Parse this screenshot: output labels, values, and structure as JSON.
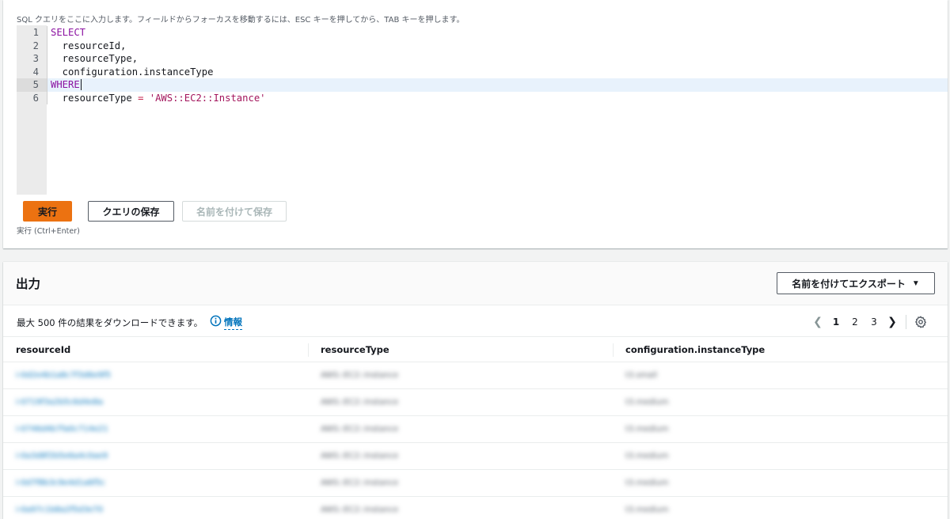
{
  "editor": {
    "hint": "SQL クエリをここに入力します。フィールドからフォーカスを移動するには、ESC キーを押してから、TAB キーを押します。",
    "lines": [
      {
        "num": "1",
        "segments": [
          {
            "t": "SELECT",
            "c": "kw"
          }
        ]
      },
      {
        "num": "2",
        "segments": [
          {
            "t": "  resourceId,",
            "c": ""
          }
        ]
      },
      {
        "num": "3",
        "segments": [
          {
            "t": "  resourceType,",
            "c": ""
          }
        ]
      },
      {
        "num": "4",
        "segments": [
          {
            "t": "  configuration.instanceType",
            "c": ""
          }
        ]
      },
      {
        "num": "5",
        "segments": [
          {
            "t": "WHERE",
            "c": "kw"
          }
        ],
        "active": true
      },
      {
        "num": "6",
        "segments": [
          {
            "t": "  resourceType ",
            "c": ""
          },
          {
            "t": "=",
            "c": "op"
          },
          {
            "t": " ",
            "c": ""
          },
          {
            "t": "'AWS::EC2::Instance'",
            "c": "str"
          }
        ]
      }
    ],
    "run_label": "実行",
    "save_label": "クエリの保存",
    "save_as_label": "名前を付けて保存",
    "run_hint": "実行 (Ctrl+Enter)"
  },
  "output": {
    "title": "出力",
    "export_label": "名前を付けてエクスポート",
    "download_text": "最大 500 件の結果をダウンロードできます。",
    "info_label": "情報",
    "pagination": {
      "pages": [
        "1",
        "2",
        "3"
      ],
      "current": "1"
    },
    "columns": [
      "resourceId",
      "resourceType",
      "configuration.instanceType"
    ],
    "rows": [
      [
        "i-0d2e4b1a8c7f3d6e9f5",
        "AWS::EC2::Instance",
        "t3.small"
      ],
      [
        "i-0719f3a2b5c6d4e8a",
        "AWS::EC2::Instance",
        "t3.medium"
      ],
      [
        "i-0746d4b7fa0c714e21",
        "AWS::EC2::Instance",
        "t3.medium"
      ],
      [
        "i-0a3d8f2b5e6a4c0ae9",
        "AWS::EC2::Instance",
        "t3.medium"
      ],
      [
        "i-0d7f8b3c9e4d1a6f5c",
        "AWS::EC2::Instance",
        "t3.medium"
      ],
      [
        "i-0a97c1b8a2f5d3e70",
        "AWS::EC2::Instance",
        "t3.medium"
      ]
    ]
  },
  "colors": {
    "primary": "#ec7211",
    "link": "#0073bb",
    "keyword": "#8b12a1",
    "string": "#a3155c"
  }
}
